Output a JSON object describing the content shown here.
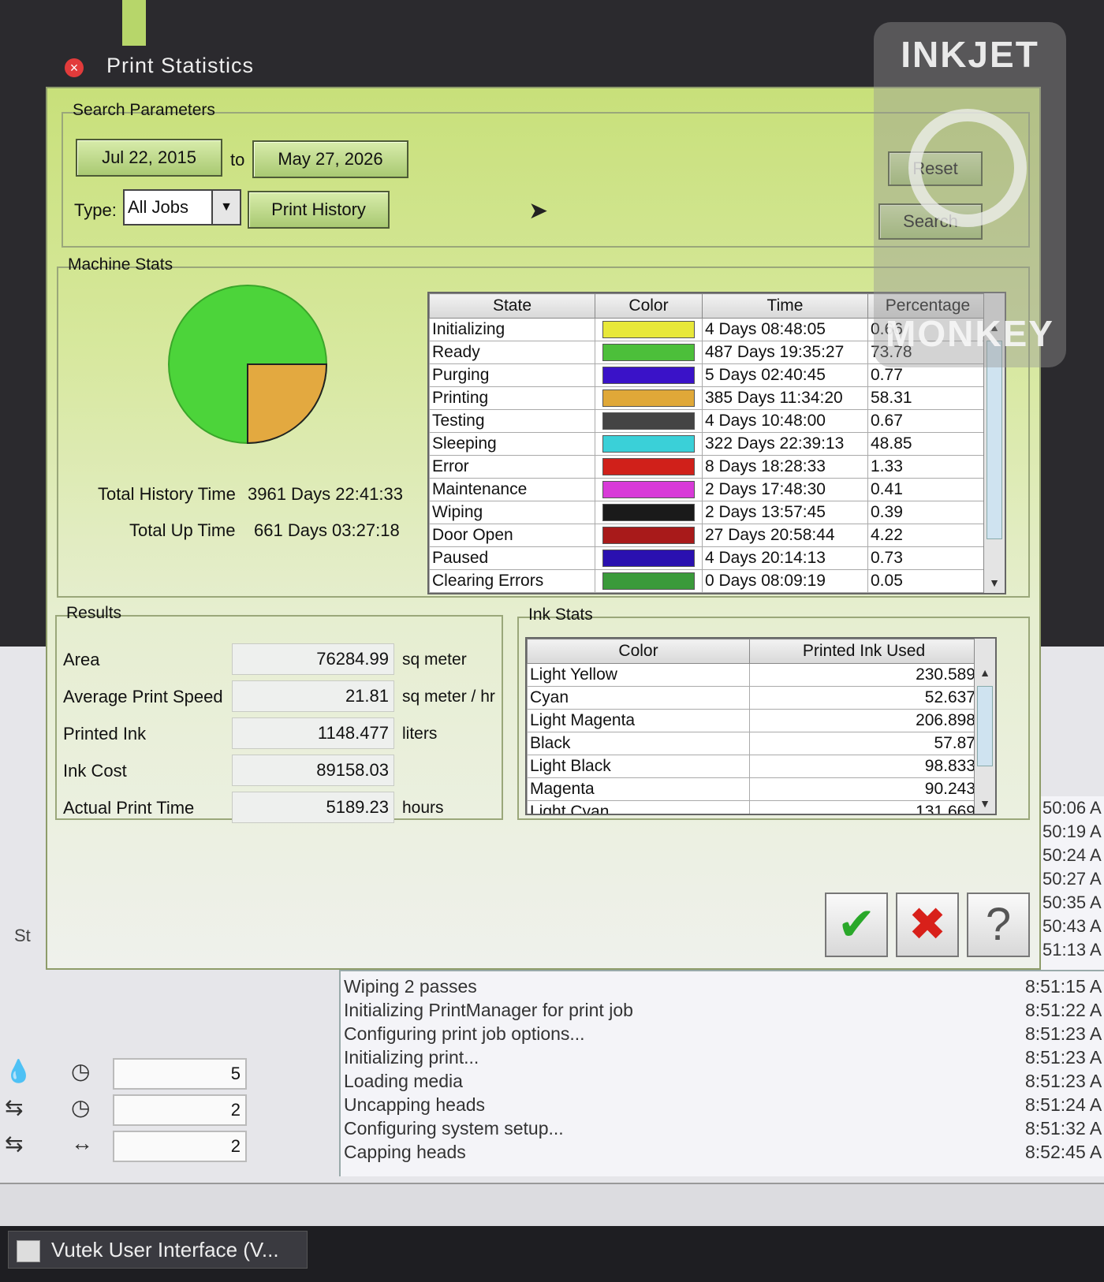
{
  "window": {
    "title": "Print Statistics"
  },
  "search": {
    "group_label": "Search Parameters",
    "from_date": "Jul 22, 2015",
    "to_label": "to",
    "to_date": "May 27, 2026",
    "type_label": "Type:",
    "type_value": "All Jobs",
    "print_history_label": "Print History",
    "reset_label": "Reset",
    "search_label": "Search"
  },
  "machine_stats": {
    "group_label": "Machine Stats",
    "total_history_label": "Total History Time",
    "total_history_value": "3961 Days 22:41:33",
    "total_up_label": "Total Up Time",
    "total_up_value": "661 Days 03:27:18",
    "headers": [
      "State",
      "Color",
      "Time",
      "Percentage"
    ],
    "rows": [
      {
        "state": "Initializing",
        "color": "#e8e83a",
        "time": "4 Days 08:48:05",
        "pct": "0.66"
      },
      {
        "state": "Ready",
        "color": "#4cbf3a",
        "time": "487 Days 19:35:27",
        "pct": "73.78"
      },
      {
        "state": "Purging",
        "color": "#3a12c8",
        "time": "5 Days 02:40:45",
        "pct": "0.77"
      },
      {
        "state": "Printing",
        "color": "#e0a838",
        "time": "385 Days 11:34:20",
        "pct": "58.31"
      },
      {
        "state": "Testing",
        "color": "#444444",
        "time": "4 Days 10:48:00",
        "pct": "0.67"
      },
      {
        "state": "Sleeping",
        "color": "#3ad0d8",
        "time": "322 Days 22:39:13",
        "pct": "48.85"
      },
      {
        "state": "Error",
        "color": "#d0201a",
        "time": "8 Days 18:28:33",
        "pct": "1.33"
      },
      {
        "state": "Maintenance",
        "color": "#d83ad8",
        "time": "2 Days 17:48:30",
        "pct": "0.41"
      },
      {
        "state": "Wiping",
        "color": "#1a1a1a",
        "time": "2 Days 13:57:45",
        "pct": "0.39"
      },
      {
        "state": "Door Open",
        "color": "#a81a1a",
        "time": "27 Days 20:58:44",
        "pct": "4.22"
      },
      {
        "state": "Paused",
        "color": "#2a10b0",
        "time": "4 Days 20:14:13",
        "pct": "0.73"
      },
      {
        "state": "Clearing Errors",
        "color": "#3a9a3a",
        "time": "0 Days 08:09:19",
        "pct": "0.05"
      }
    ]
  },
  "results": {
    "group_label": "Results",
    "rows": [
      {
        "label": "Area",
        "value": "76284.99",
        "unit": "sq meter"
      },
      {
        "label": "Average Print Speed",
        "value": "21.81",
        "unit": "sq meter / hr"
      },
      {
        "label": "Printed Ink",
        "value": "1148.477",
        "unit": "liters"
      },
      {
        "label": "Ink Cost",
        "value": "89158.03",
        "unit": ""
      },
      {
        "label": "Actual Print Time",
        "value": "5189.23",
        "unit": "hours"
      }
    ]
  },
  "ink_stats": {
    "group_label": "Ink Stats",
    "headers": [
      "Color",
      "Printed Ink Used"
    ],
    "rows": [
      {
        "color": "Light Yellow",
        "used": "230.589"
      },
      {
        "color": "Cyan",
        "used": "52.637"
      },
      {
        "color": "Light Magenta",
        "used": "206.898"
      },
      {
        "color": "Black",
        "used": "57.87"
      },
      {
        "color": "Light Black",
        "used": "98.833"
      },
      {
        "color": "Magenta",
        "used": "90.243"
      },
      {
        "color": "Light Cyan",
        "used": "131.669"
      }
    ]
  },
  "actions": {
    "ok_glyph": "✔",
    "cancel_glyph": "✖",
    "help_glyph": "?"
  },
  "watermark": {
    "top": "INKJET",
    "bottom": "MONKEY"
  },
  "background": {
    "log": [
      {
        "msg": "Wiping 2 passes",
        "time": "8:51:15 A"
      },
      {
        "msg": "Initializing PrintManager for print job",
        "time": "8:51:22 A"
      },
      {
        "msg": "Configuring print job options...",
        "time": "8:51:23 A"
      },
      {
        "msg": "Initializing print...",
        "time": "8:51:23 A"
      },
      {
        "msg": "Loading media",
        "time": "8:51:23 A"
      },
      {
        "msg": "Uncapping heads",
        "time": "8:51:24 A"
      },
      {
        "msg": "Configuring system setup...",
        "time": "8:51:32 A"
      },
      {
        "msg": "Capping heads",
        "time": "8:52:45 A"
      }
    ],
    "side_times": [
      "50:06 A",
      "50:19 A",
      "50:24 A",
      "50:27 A",
      "50:35 A",
      "50:43 A",
      "51:13 A"
    ],
    "steppers": [
      "5",
      "2",
      "2"
    ],
    "stub_label": "St"
  },
  "taskbar": {
    "app_label": "Vutek User Interface (V..."
  }
}
